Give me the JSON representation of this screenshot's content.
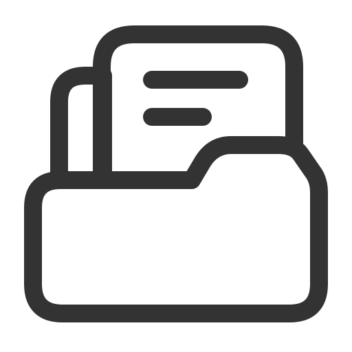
{
  "icon": {
    "name": "folder-with-documents-icon",
    "stroke_color": "#333333",
    "fill_color": "#ffffff",
    "background": "#ffffff"
  }
}
